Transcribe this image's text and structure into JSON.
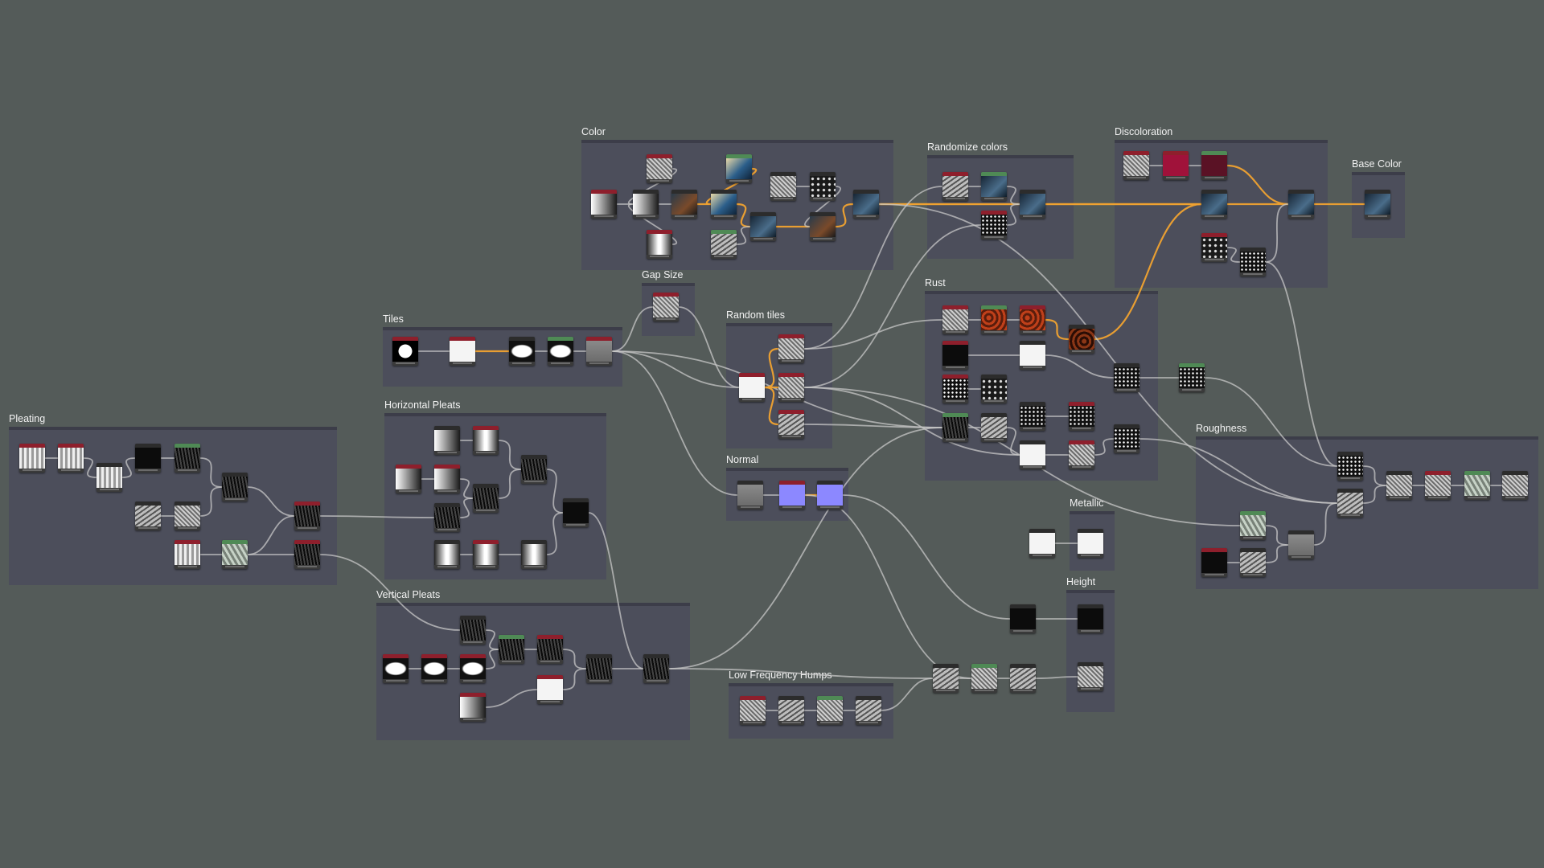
{
  "app": {
    "canvas_label": "Substance graph canvas"
  },
  "frames": [
    {
      "id": "color",
      "title": "Color"
    },
    {
      "id": "randomize",
      "title": "Randomize colors"
    },
    {
      "id": "discoloration",
      "title": "Discoloration"
    },
    {
      "id": "basecolor",
      "title": "Base Color"
    },
    {
      "id": "gapsize",
      "title": "Gap Size"
    },
    {
      "id": "tiles",
      "title": "Tiles"
    },
    {
      "id": "randomtiles",
      "title": "Random tiles"
    },
    {
      "id": "rust",
      "title": "Rust"
    },
    {
      "id": "pleating",
      "title": "Pleating"
    },
    {
      "id": "hpleats",
      "title": "Horizontal Pleats"
    },
    {
      "id": "normal",
      "title": "Normal"
    },
    {
      "id": "roughness",
      "title": "Roughness"
    },
    {
      "id": "metallic",
      "title": "Metallic"
    },
    {
      "id": "height",
      "title": "Height"
    },
    {
      "id": "vpleats",
      "title": "Vertical Pleats"
    },
    {
      "id": "lfhumps",
      "title": "Low Frequency Humps"
    }
  ],
  "node_header_colors": {
    "red": "#8e1f2c",
    "green": "#4f8a55",
    "dark": "#2c2c2c"
  },
  "wire_colors": {
    "grayscale": "#c7c7c7",
    "color": "#f0a230"
  }
}
